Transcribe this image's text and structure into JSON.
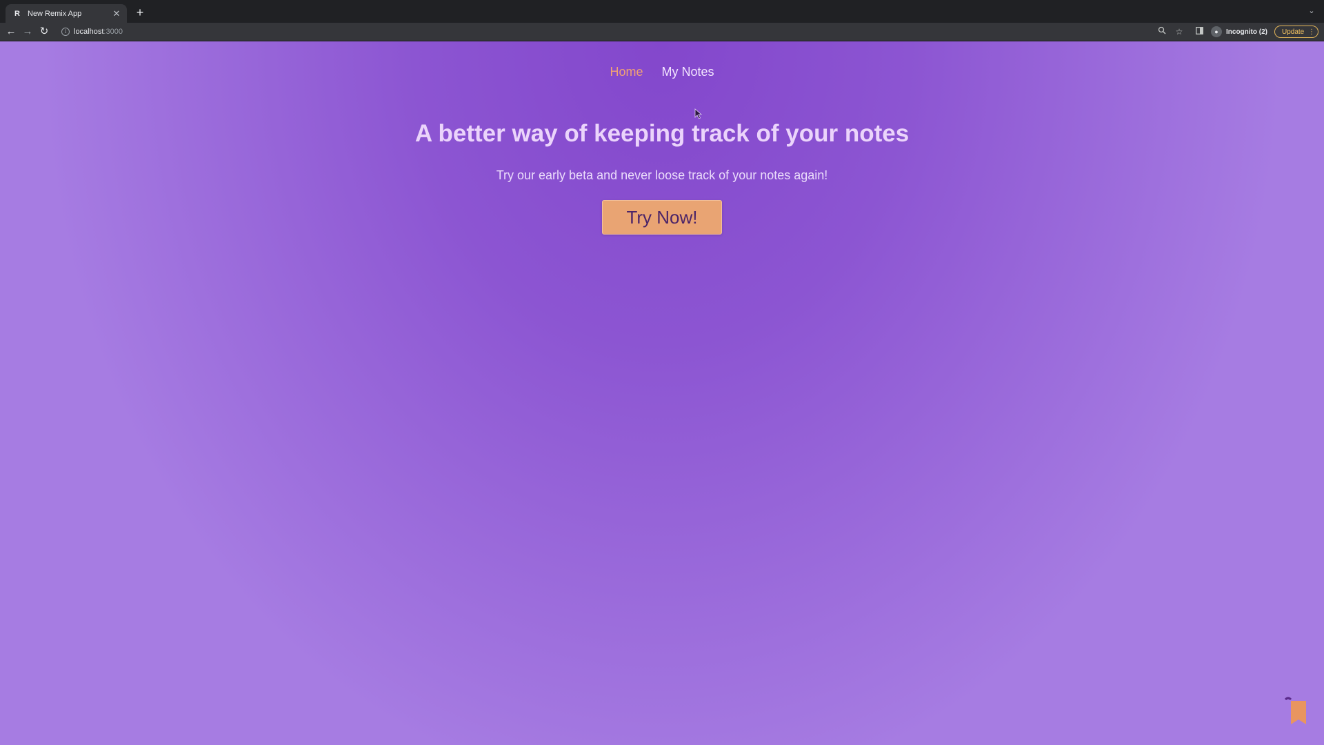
{
  "browser": {
    "tab": {
      "favicon": "R",
      "title": "New Remix App"
    },
    "url": {
      "host": "localhost",
      "port": ":3000"
    },
    "profile_label": "Incognito (2)",
    "update_label": "Update",
    "icons": [
      "back-arrow-icon",
      "forward-arrow-icon",
      "reload-icon",
      "info-icon",
      "zoom-icon",
      "star-icon",
      "side-panel-icon",
      "incognito-icon",
      "kebab-menu-icon",
      "tab-search-icon",
      "new-tab-plus-icon",
      "close-icon"
    ]
  },
  "nav": {
    "items": [
      {
        "label": "Home",
        "active": true
      },
      {
        "label": "My Notes",
        "active": false
      }
    ]
  },
  "hero": {
    "title": "A better way of keeping track of your notes",
    "subtitle": "Try our early beta and never loose track of your notes again!",
    "cta_label": "Try Now!"
  },
  "colors": {
    "background_center": "#8347cc",
    "background_edge": "#a67ce2",
    "accent": "#f1a275",
    "button": "#e9a473",
    "title": "#ebd4fb"
  }
}
